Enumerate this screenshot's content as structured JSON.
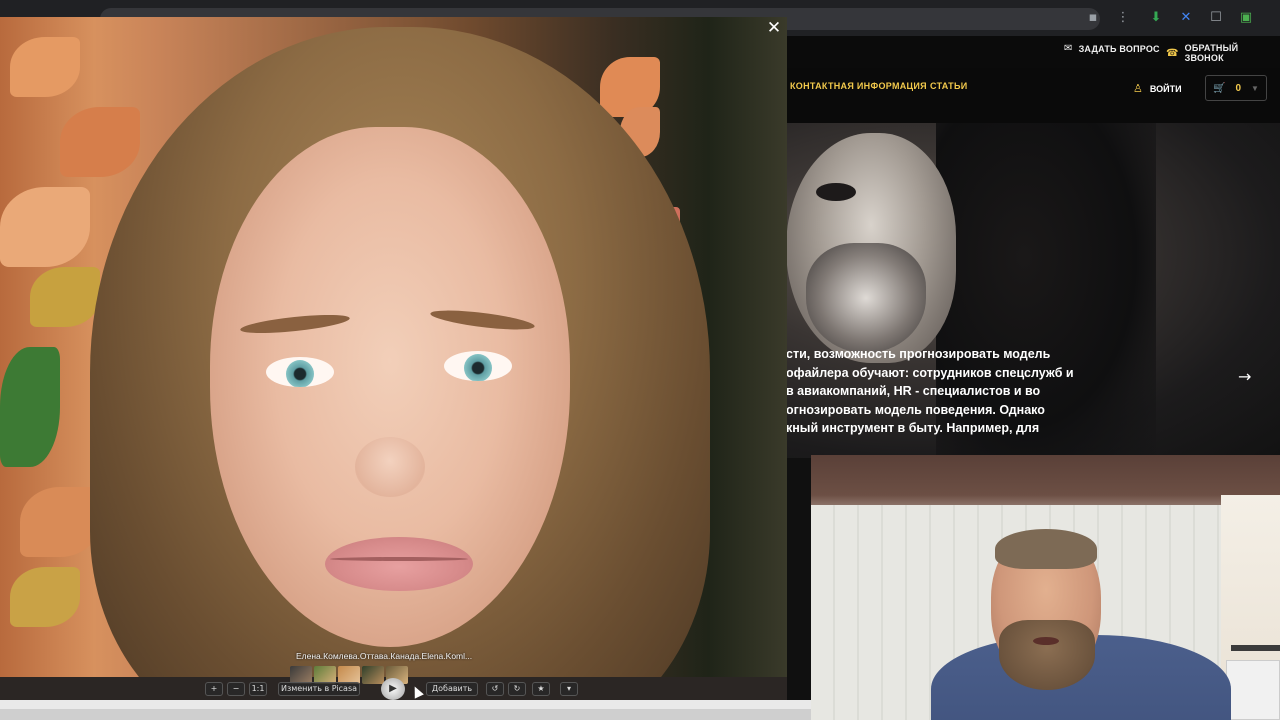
{
  "colors": {
    "accent": "#f2c94c",
    "site_bg": "#101010",
    "text_light": "#ffffff"
  },
  "site": {
    "topbar": {
      "ask_question": "ЗАДАТЬ ВОПРОС",
      "callback": "ОБРАТНЫЙ ЗВОНОК"
    },
    "nav": {
      "items": [
        "КОНТАКТНАЯ ИНФОРМАЦИЯ",
        "СТАТЬИ"
      ],
      "login": "ВОЙТИ",
      "cart_count": "0"
    },
    "hero": {
      "lines": [
        "сти, возможность прогнозировать модель",
        "офайлера обучают: сотрудников спецслужб и",
        "в авиакомпаний, HR - специалистов и во",
        "огнозировать модель поведения. Однако",
        "кный инструмент в быту. Например, для"
      ],
      "next_icon": "arrow-right-icon"
    }
  },
  "lightbox": {
    "close_icon": "close-icon",
    "caption": "Елена.Комлева.Оттава.Канада.Elena.Koml...",
    "toolbar": {
      "zoom_in": "+",
      "zoom_out": "−",
      "actual_size": "1:1",
      "edit_label": "Изменить в Picasa",
      "add_label": "Добавить"
    }
  }
}
